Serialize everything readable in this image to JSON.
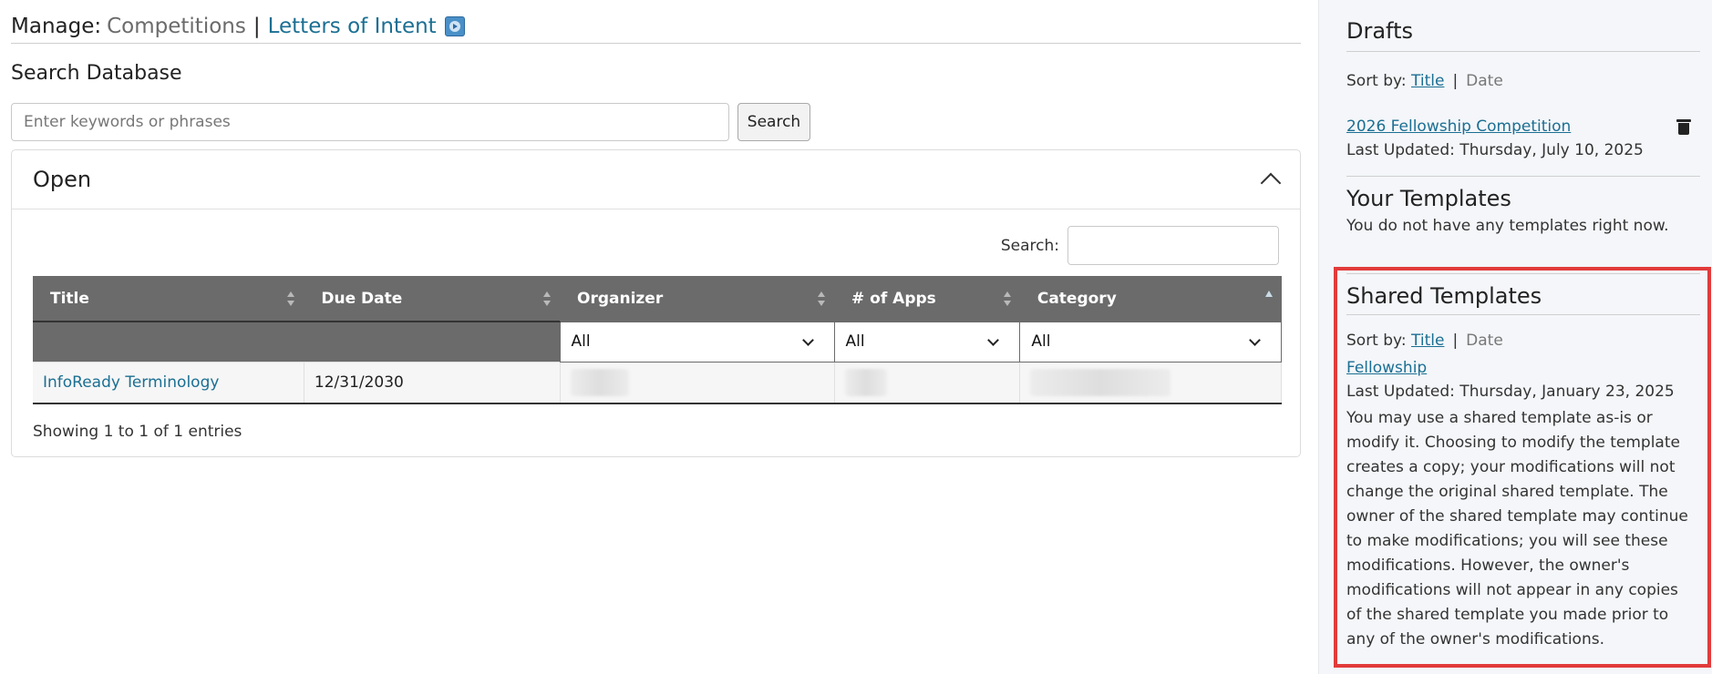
{
  "header": {
    "manage_label": "Manage:",
    "competitions_link": "Competitions",
    "separator": "|",
    "letters_link": "Letters of Intent",
    "video_icon": "video-help-icon"
  },
  "search": {
    "title": "Search Database",
    "placeholder": "Enter keywords or phrases",
    "button_label": "Search"
  },
  "panel": {
    "title": "Open",
    "collapse_icon": "chevron-up-icon",
    "table_search_label": "Search:",
    "columns": [
      "Title",
      "Due Date",
      "Organizer",
      "# of Apps",
      "Category"
    ],
    "filters": {
      "organizer": "All",
      "apps": "All",
      "category": "All"
    },
    "rows": [
      {
        "title": "InfoReady Terminology",
        "due_date": "12/31/2030"
      }
    ],
    "info": "Showing 1 to 1 of 1 entries"
  },
  "sidebar": {
    "drafts": {
      "title": "Drafts",
      "sort_by": "Sort by:",
      "sort_title": "Title",
      "sort_separator": "|",
      "sort_date": "Date",
      "item_title": "2026 Fellowship Competition",
      "item_updated": "Last Updated: Thursday, July 10, 2025",
      "delete_icon": "trash-icon"
    },
    "your_templates": {
      "title": "Your Templates",
      "empty_text": "You do not have any templates right now."
    },
    "shared_templates": {
      "title": "Shared Templates",
      "sort_by": "Sort by:",
      "sort_title": "Title",
      "sort_separator": "|",
      "sort_date": "Date",
      "item_title": "Fellowship",
      "item_updated": "Last Updated: Thursday, January 23, 2025",
      "description": "You may use a shared template as-is or modify it. Choosing to modify the template creates a copy; your modifications will not change the original shared template. The owner of the shared template may continue to make modifications; you will see these modifications. However, the owner's modifications will not appear in any copies of the shared template you made prior to any of the owner's modifications."
    }
  },
  "colors": {
    "link": "#1b6f93",
    "table_header": "#6b6b6b",
    "highlight_border": "#e23b3b",
    "sidebar_bg": "#f4f6f9"
  }
}
